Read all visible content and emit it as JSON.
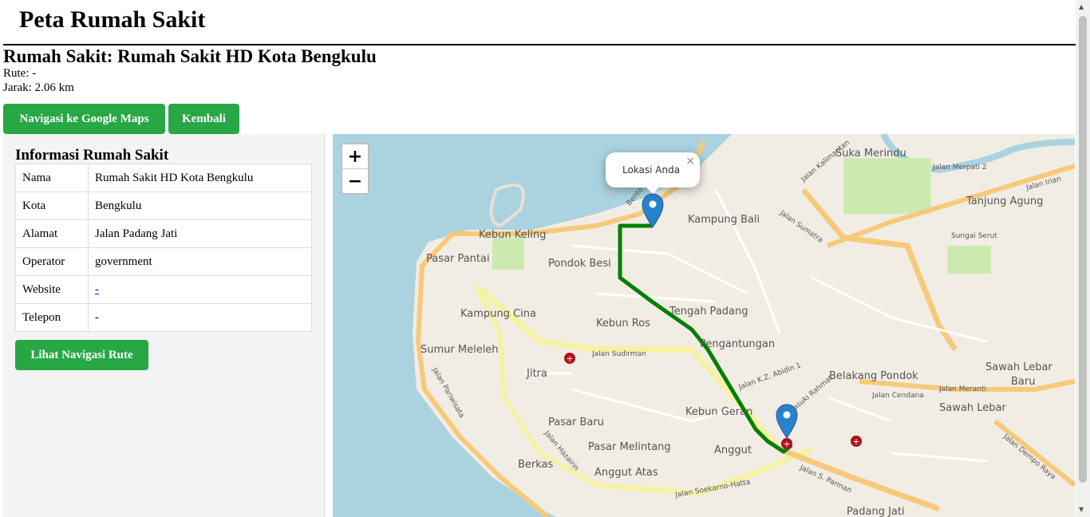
{
  "header": {
    "title": "Peta Rumah Sakit"
  },
  "hospital": {
    "heading": "Rumah Sakit: Rumah Sakit HD Kota Bengkulu",
    "route_line": "Rute: -",
    "distance_line": "Jarak: 2.06 km"
  },
  "actions": {
    "google_maps_label": "Navigasi ke Google Maps",
    "back_label": "Kembali"
  },
  "sidebar": {
    "title": "Informasi Rumah Sakit",
    "rows": [
      {
        "key": "Nama",
        "value": "Rumah Sakit HD Kota Bengkulu"
      },
      {
        "key": "Kota",
        "value": "Bengkulu"
      },
      {
        "key": "Alamat",
        "value": "Jalan Padang Jati"
      },
      {
        "key": "Operator",
        "value": "government"
      },
      {
        "key": "Website",
        "value": "-"
      },
      {
        "key": "Telepon",
        "value": "-"
      }
    ],
    "route_button_label": "Lihat Navigasi Rute"
  },
  "map": {
    "zoom_in": "+",
    "zoom_out": "−",
    "popup_text": "Lokasi Anda",
    "popup_close": "×",
    "route_color": "#008000",
    "marker_color": "#2a81cb",
    "hospital_icon_color": "#b0101e",
    "labels": {
      "suka_merindu": "Suka Merindu",
      "jalan_merpati": "Jalan Merpati 2",
      "jalan_kalimantan": "Jalan Kalimantan",
      "tanjung_agung": "Tanjung Agung",
      "jalan_irian": "Jalan Irian",
      "kebun_keling": "Kebun Keling",
      "pasar_pantai": "Pasar Pantai",
      "pondok_besi": "Pondok Besi",
      "kampung_bali": "Kampung Bali",
      "jalan_sumatra": "Jalan Sumatra",
      "sungai_serut": "Sungai Serut",
      "kampung_cina": "Kampung Cina",
      "tengah_padang": "Tengah Padang",
      "kebun_ros": "Kebun Ros",
      "sumur_meleleh": "Sumur Meleleh",
      "pengantungan": "Pengantungan",
      "jalan_sudirman": "Jalan Sudirman",
      "jitra": "Jitra",
      "belakang_pondok": "Belakang Pondok",
      "sawah_lebar_baru_1": "Sawah Lebar",
      "sawah_lebar_baru_2": "Baru",
      "jalan_cendana": "Jalan Cendana",
      "jalan_meranti": "Jalan Meranti",
      "sawah_lebar": "Sawah Lebar",
      "kebun_geran": "Kebun Geran",
      "pasar_baru": "Pasar Baru",
      "pasar_melintang": "Pasar Melintang",
      "anggut": "Anggut",
      "berkas": "Berkas",
      "anggut_atas": "Anggut Atas",
      "jalan_soekarno_hatta": "Jalan Soekarno-Hatta",
      "jalan_s_parman": "Jalan S. Parman",
      "padang_jati": "Padang Jati",
      "jalan_basuki_rahmat": "Basuki Rahmat",
      "jalan_pariwisata": "Jalan Pariwisata",
      "jalan_hazairin": "Jalan Hazairin",
      "jalan_dempo_raya": "Jalan Dempo Raya",
      "jalan_k_z_abidin": "Jalan K.Z. Abidin 1",
      "benteng": "Bento"
    }
  }
}
